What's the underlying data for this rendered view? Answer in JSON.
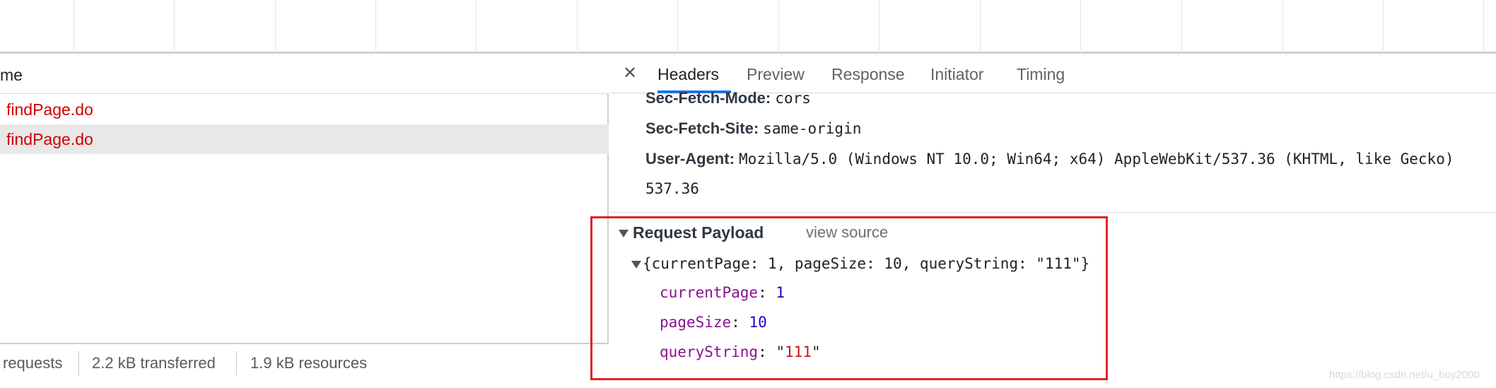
{
  "requests_list": {
    "column_header": "me",
    "rows": [
      {
        "name": "findPage.do",
        "selected": false
      },
      {
        "name": "findPage.do",
        "selected": true
      }
    ],
    "status_bar": {
      "requests": "requests",
      "transferred": "2.2 kB transferred",
      "resources": "1.9 kB resources"
    }
  },
  "details": {
    "close_icon": "close-icon",
    "tabs": [
      {
        "label": "Headers",
        "active": true
      },
      {
        "label": "Preview",
        "active": false
      },
      {
        "label": "Response",
        "active": false
      },
      {
        "label": "Initiator",
        "active": false
      },
      {
        "label": "Timing",
        "active": false
      }
    ],
    "headers": [
      {
        "key": "Sec-Fetch-Mode:",
        "value": "cors"
      },
      {
        "key": "Sec-Fetch-Site:",
        "value": "same-origin"
      },
      {
        "key": "User-Agent:",
        "value": "Mozilla/5.0 (Windows NT 10.0; Win64; x64) AppleWebKit/537.36 (KHTML, like Gecko)"
      },
      {
        "key": "",
        "value": "537.36"
      }
    ],
    "request_payload": {
      "title": "Request Payload",
      "view_source_label": "view source",
      "summary": "{currentPage: 1, pageSize: 10, queryString: \"111\"}",
      "properties": [
        {
          "key": "currentPage",
          "value": "1",
          "type": "number"
        },
        {
          "key": "pageSize",
          "value": "10",
          "type": "number"
        },
        {
          "key": "queryString",
          "value": "111",
          "type": "string"
        }
      ]
    },
    "highlight_color": "#e3202a"
  },
  "watermark": "https://blog.csdn.net/u_boy2000"
}
